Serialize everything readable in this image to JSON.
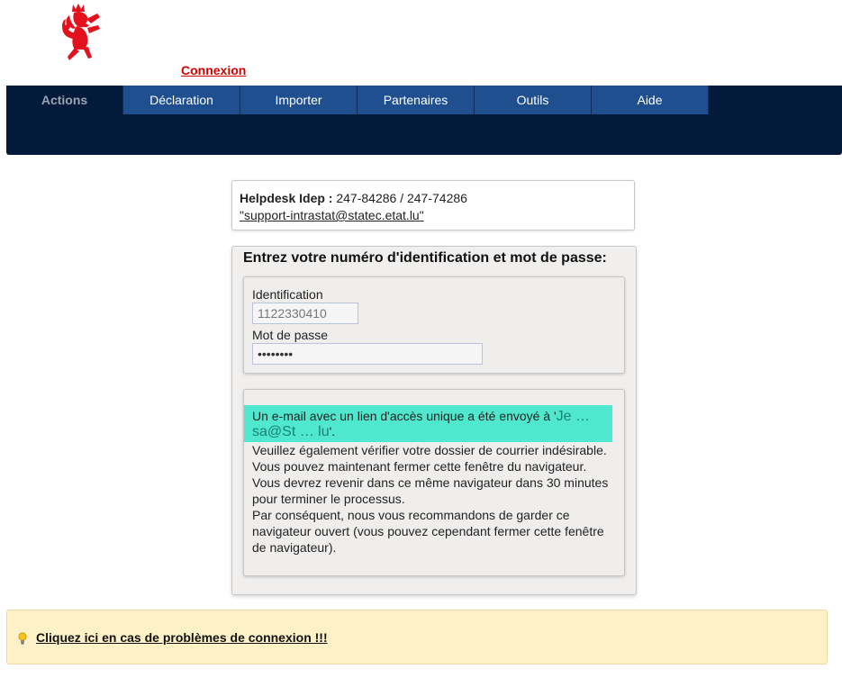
{
  "header": {
    "login_link": "Connexion"
  },
  "nav": {
    "tabs": [
      {
        "label": "Actions",
        "active": true
      },
      {
        "label": "Déclaration"
      },
      {
        "label": "Importer"
      },
      {
        "label": "Partenaires"
      },
      {
        "label": "Outils"
      },
      {
        "label": "Aide"
      }
    ]
  },
  "helpdesk": {
    "label": "Helpdesk Idep :",
    "phones": "247-84286 / 247-74286",
    "email": "\"support-intrastat@statec.etat.lu\""
  },
  "login": {
    "title": "Entrez votre numéro d'identification et mot de passe:",
    "id_label": "Identification",
    "id_value": "1122330410",
    "password_label": "Mot de passe",
    "password_value": "••••••••"
  },
  "message": {
    "prefix": "Un e-mail avec un lien d'accès unique a été envoyé à '",
    "email_masked": "Je … sa@St … lu",
    "suffix": "'.",
    "body": "Veuillez également vérifier votre dossier de courrier indésirable.\nVous pouvez maintenant fermer cette fenêtre du navigateur.\nVous devrez revenir dans ce même navigateur dans 30 minutes pour terminer le processus.\nPar conséquent, nous vous recommandons de garder ce navigateur ouvert (vous pouvez cependant fermer cette fenêtre de navigateur)."
  },
  "help": {
    "link": "Cliquez ici en cas de problèmes de connexion !!!"
  },
  "colors": {
    "nav_bg": "#041a3b",
    "tab_bg": "#1f4f8f",
    "link_red": "#d40000",
    "highlight": "#4fe8cf",
    "help_bg": "#fdf1c7"
  }
}
